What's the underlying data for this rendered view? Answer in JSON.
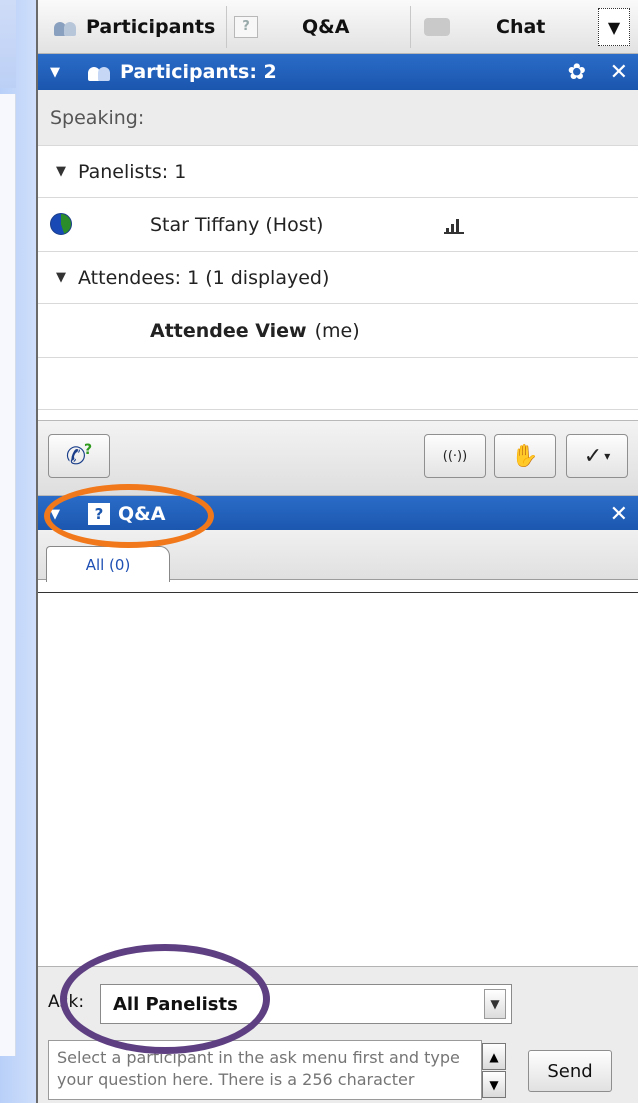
{
  "tabs": {
    "participants": "Participants",
    "qa": "Q&A",
    "chat": "Chat",
    "overflow_icon": "chevron-down-icon"
  },
  "participants_panel": {
    "title": "Participants: 2",
    "speaking_label": "Speaking:",
    "panelists_group": "Panelists: 1",
    "host": {
      "name": "Star Tiffany (Host)"
    },
    "attendees_group": "Attendees: 1 (1 displayed)",
    "me": {
      "name": "Attendee View",
      "suffix": "(me)"
    }
  },
  "toolbar": {
    "icons": [
      "phone-help-icon",
      "broadcast-icon",
      "raise-hand-icon",
      "checkmark-dropdown-icon"
    ]
  },
  "qa_panel": {
    "title": "Q&A",
    "tab_all": "All (0)"
  },
  "ask": {
    "label": "Ask:",
    "selected": "All Panelists",
    "placeholder": "Select a participant in the ask menu first and type your question here. There is a 256 character",
    "send": "Send"
  },
  "colors": {
    "header_blue": "#1b56ae",
    "annotation_orange": "#f2791b",
    "annotation_purple": "#5e3f82"
  }
}
